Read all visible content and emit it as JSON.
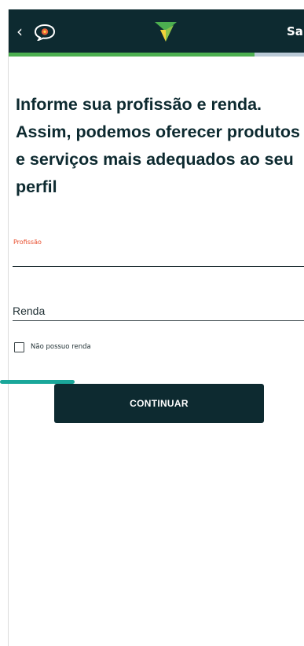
{
  "header": {
    "back_icon": "chevron-left-icon",
    "chat_icon": "chat-bubble-icon",
    "logo_icon": "bank-logo-icon",
    "exit_label": "Sai",
    "colors": {
      "bar": "#0d2a30",
      "logo_green": "#4caf50",
      "logo_yellow": "#f2d23a",
      "chat_accent": "#e8623a"
    }
  },
  "progress": {
    "percent": 83,
    "fill_color": "#4caf50",
    "track_color": "#b9c9d6"
  },
  "main": {
    "heading": "Informe sua profissão e renda. Assim, podemos oferecer produtos e serviços mais adequados ao seu perfil",
    "profession_label": "Profissão",
    "profession_value": "",
    "income_placeholder": "Renda",
    "income_value": "",
    "no_income_checkbox": {
      "label": "Não possuo renda",
      "checked": false
    },
    "continue_label": "CONTINUAR"
  },
  "colors": {
    "primary_dark": "#0d2a30",
    "label_accent": "#e84b2a",
    "pointer": "#1aa79a"
  }
}
